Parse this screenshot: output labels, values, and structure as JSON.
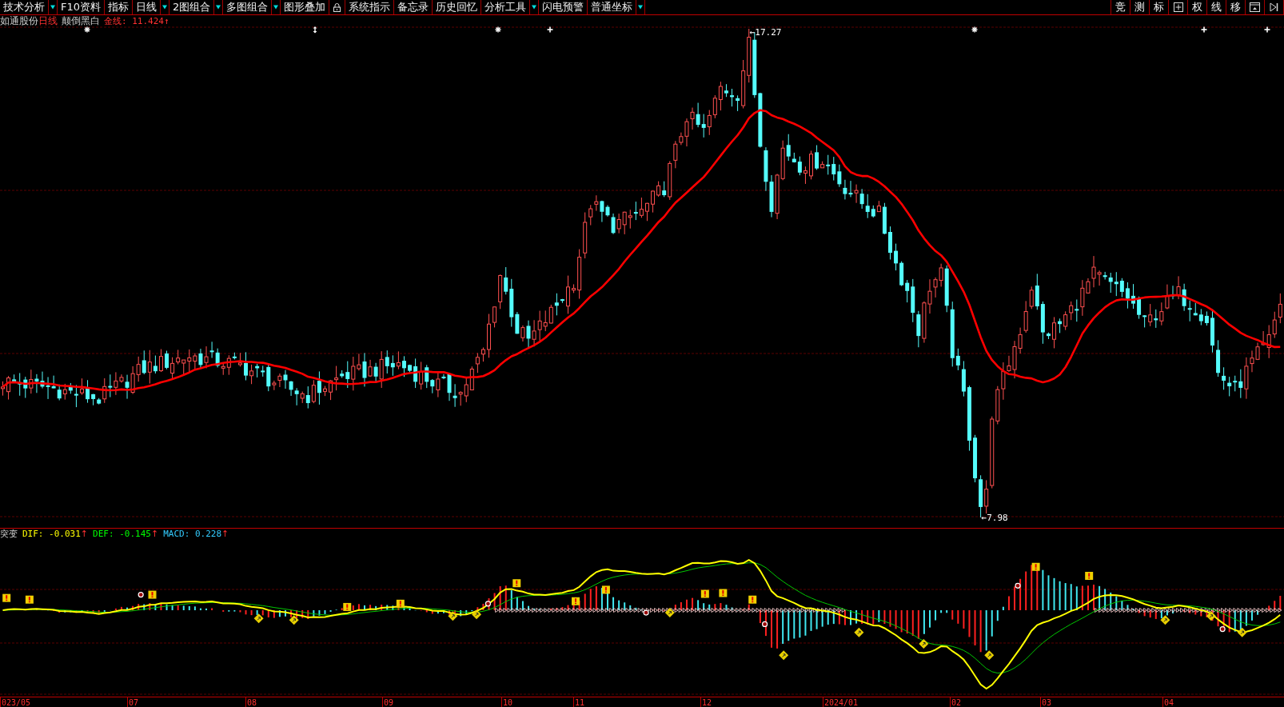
{
  "toolbar": {
    "left": [
      {
        "kind": "text",
        "label": "技术分析",
        "dropdown": true
      },
      {
        "kind": "text",
        "label": "F10资料",
        "dropdown": false
      },
      {
        "kind": "text",
        "label": "指标",
        "dropdown": false
      },
      {
        "kind": "text",
        "label": "日线",
        "dropdown": true
      },
      {
        "kind": "text",
        "label": "2图组合",
        "dropdown": true
      },
      {
        "kind": "text",
        "label": "多图组合",
        "dropdown": true
      },
      {
        "kind": "text",
        "label": "图形叠加",
        "dropdown": false
      },
      {
        "kind": "lock",
        "dropdown": false
      },
      {
        "kind": "text",
        "label": "系统指示",
        "dropdown": false
      },
      {
        "kind": "text",
        "label": "备忘录",
        "dropdown": false
      },
      {
        "kind": "text",
        "label": "历史回忆",
        "dropdown": false
      },
      {
        "kind": "text",
        "label": "分析工具",
        "dropdown": true
      },
      {
        "kind": "text",
        "label": "闪电预警",
        "dropdown": false
      },
      {
        "kind": "text",
        "label": "普通坐标",
        "dropdown": true
      }
    ],
    "right": [
      {
        "kind": "text",
        "label": "竞"
      },
      {
        "kind": "text",
        "label": "测"
      },
      {
        "kind": "text",
        "label": "标"
      },
      {
        "kind": "grid"
      },
      {
        "kind": "text",
        "label": "权"
      },
      {
        "kind": "text",
        "label": "线"
      },
      {
        "kind": "text",
        "label": "移"
      },
      {
        "kind": "window"
      },
      {
        "kind": "end"
      }
    ]
  },
  "info_bar": {
    "stock_name": "如通股份",
    "period": "日线",
    "indicator": "颠倒黑白",
    "value": "金线: 11.424↑"
  },
  "price_chart": {
    "high_label": "←17.27",
    "low_label": "←7.98"
  },
  "indicator_header": {
    "name": "突变",
    "values": [
      {
        "label": "DIF: -0.031",
        "arrow": "↑",
        "color": "#ffff00"
      },
      {
        "label": "DEF: -0.145",
        "arrow": "↑",
        "color": "#00ff00"
      },
      {
        "label": "MACD: 0.228",
        "arrow": "↑",
        "color": "#33ccff"
      }
    ]
  },
  "date_axis": {
    "labels": [
      "023/05",
      "07",
      "08",
      "09",
      "10",
      "11",
      "12",
      "2024/01",
      "02",
      "03",
      "04"
    ]
  }
}
